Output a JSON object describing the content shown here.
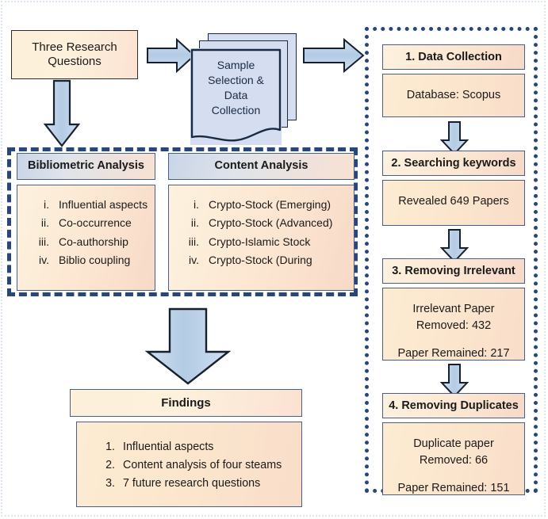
{
  "diagram": {
    "title": "Research methodology flow diagram",
    "colors": {
      "dashed_border": "#27467c",
      "dotted_border": "#27467c",
      "box_border": "#4a5f86",
      "arrow_fill": "#b9d0e8",
      "arrow_stroke": "#1a1a1a",
      "document_fill": "#d4def0",
      "peach_fill": "#fbe6cd",
      "outer_frame": "#dce6f2"
    }
  },
  "start": {
    "label": "Three Research\nQuestions",
    "line1": "Three Research",
    "line2": "Questions"
  },
  "document": {
    "label": "Sample\nSelection &\nData\nCollection",
    "line1": "Sample",
    "line2": "Selection &",
    "line3": "Data",
    "line4": "Collection"
  },
  "arrows": {
    "right_1": "arrow-right-icon",
    "right_2": "arrow-right-icon",
    "down_start": "arrow-down-icon",
    "down_findings": "arrow-down-icon",
    "pipeline_1": "arrow-down-icon",
    "pipeline_2": "arrow-down-icon",
    "pipeline_3": "arrow-down-icon"
  },
  "analysis": {
    "bibliometric": {
      "header": "Bibliometric Analysis",
      "items": [
        {
          "num": "i.",
          "text": "Influential aspects"
        },
        {
          "num": "ii.",
          "text": "Co-occurrence"
        },
        {
          "num": "iii.",
          "text": "Co-authorship"
        },
        {
          "num": "iv.",
          "text": "Biblio coupling"
        }
      ]
    },
    "content": {
      "header": "Content Analysis",
      "items": [
        {
          "num": "i.",
          "text": "Crypto-Stock (Emerging)"
        },
        {
          "num": "ii.",
          "text": "Crypto-Stock (Advanced)"
        },
        {
          "num": "iii.",
          "text": "Crypto-Islamic Stock"
        },
        {
          "num": "iv.",
          "text": "Crypto-Stock (During"
        }
      ]
    }
  },
  "findings": {
    "header": "Findings",
    "items": [
      {
        "num": "1.",
        "text": "Influential aspects"
      },
      {
        "num": "2.",
        "text": "Content analysis of four steams"
      },
      {
        "num": "3.",
        "text": "7 future research questions"
      }
    ]
  },
  "pipeline": {
    "steps": [
      {
        "title": "1. Data Collection",
        "body": "Database: Scopus"
      },
      {
        "title": "2. Searching keywords",
        "body": "Revealed 649 Papers"
      },
      {
        "title": "3. Removing Irrelevant",
        "body": "Irrelevant Paper\nRemoved: 432\n\nPaper Remained: 217"
      },
      {
        "title": "4. Removing Duplicates",
        "body": "Duplicate paper\nRemoved: 66\n\nPaper Remained: 151"
      }
    ],
    "step3_lines": {
      "l1": "Irrelevant Paper",
      "l2": "Removed: 432",
      "l3": "Paper Remained: 217"
    },
    "step4_lines": {
      "l1": "Duplicate paper",
      "l2": "Removed: 66",
      "l3": "Paper Remained: 151"
    }
  }
}
